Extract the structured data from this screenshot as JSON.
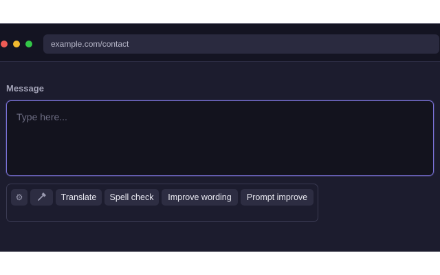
{
  "browser": {
    "url": "example.com/contact",
    "traffic_lights": [
      "close",
      "minimize",
      "maximize"
    ]
  },
  "form": {
    "message_label": "Message",
    "message_placeholder": "Type here...",
    "message_value": ""
  },
  "toolbar": {
    "settings_icon": "gear-icon",
    "tools_icon": "hammer-icon",
    "translate_label": "Translate",
    "spell_check_label": "Spell check",
    "improve_wording_label": "Improve wording",
    "prompt_improve_label": "Prompt improve"
  },
  "colors": {
    "accent": "#7a72d8",
    "background": "#1c1c2e",
    "input_background": "#13131e",
    "button_background": "#2d2d42"
  }
}
